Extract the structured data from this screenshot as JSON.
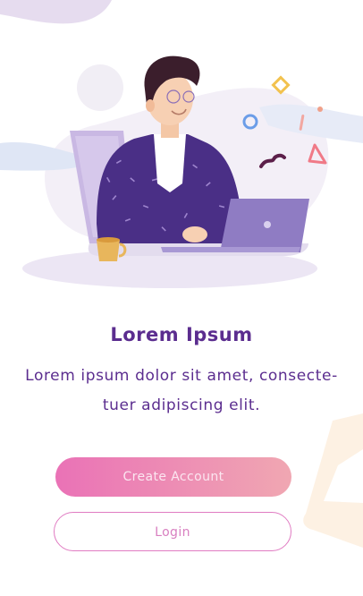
{
  "onboarding": {
    "title": "Lorem Ipsum",
    "description_line1": "Lorem ipsum dolor sit amet, consecte-",
    "description_line2": "tuer adipiscing elit."
  },
  "actions": {
    "create_account_label": "Create Account",
    "login_label": "Login"
  },
  "colors": {
    "accent_purple": "#5b2d8f",
    "button_gradient_start": "#ea72b6",
    "button_gradient_end": "#f0a7b2",
    "login_border": "#e07bc2"
  },
  "illustration": {
    "subject": "person-working-on-laptop",
    "items": [
      "laptop-icon",
      "coffee-cup-icon",
      "chair-icon",
      "confetti-shapes"
    ]
  }
}
